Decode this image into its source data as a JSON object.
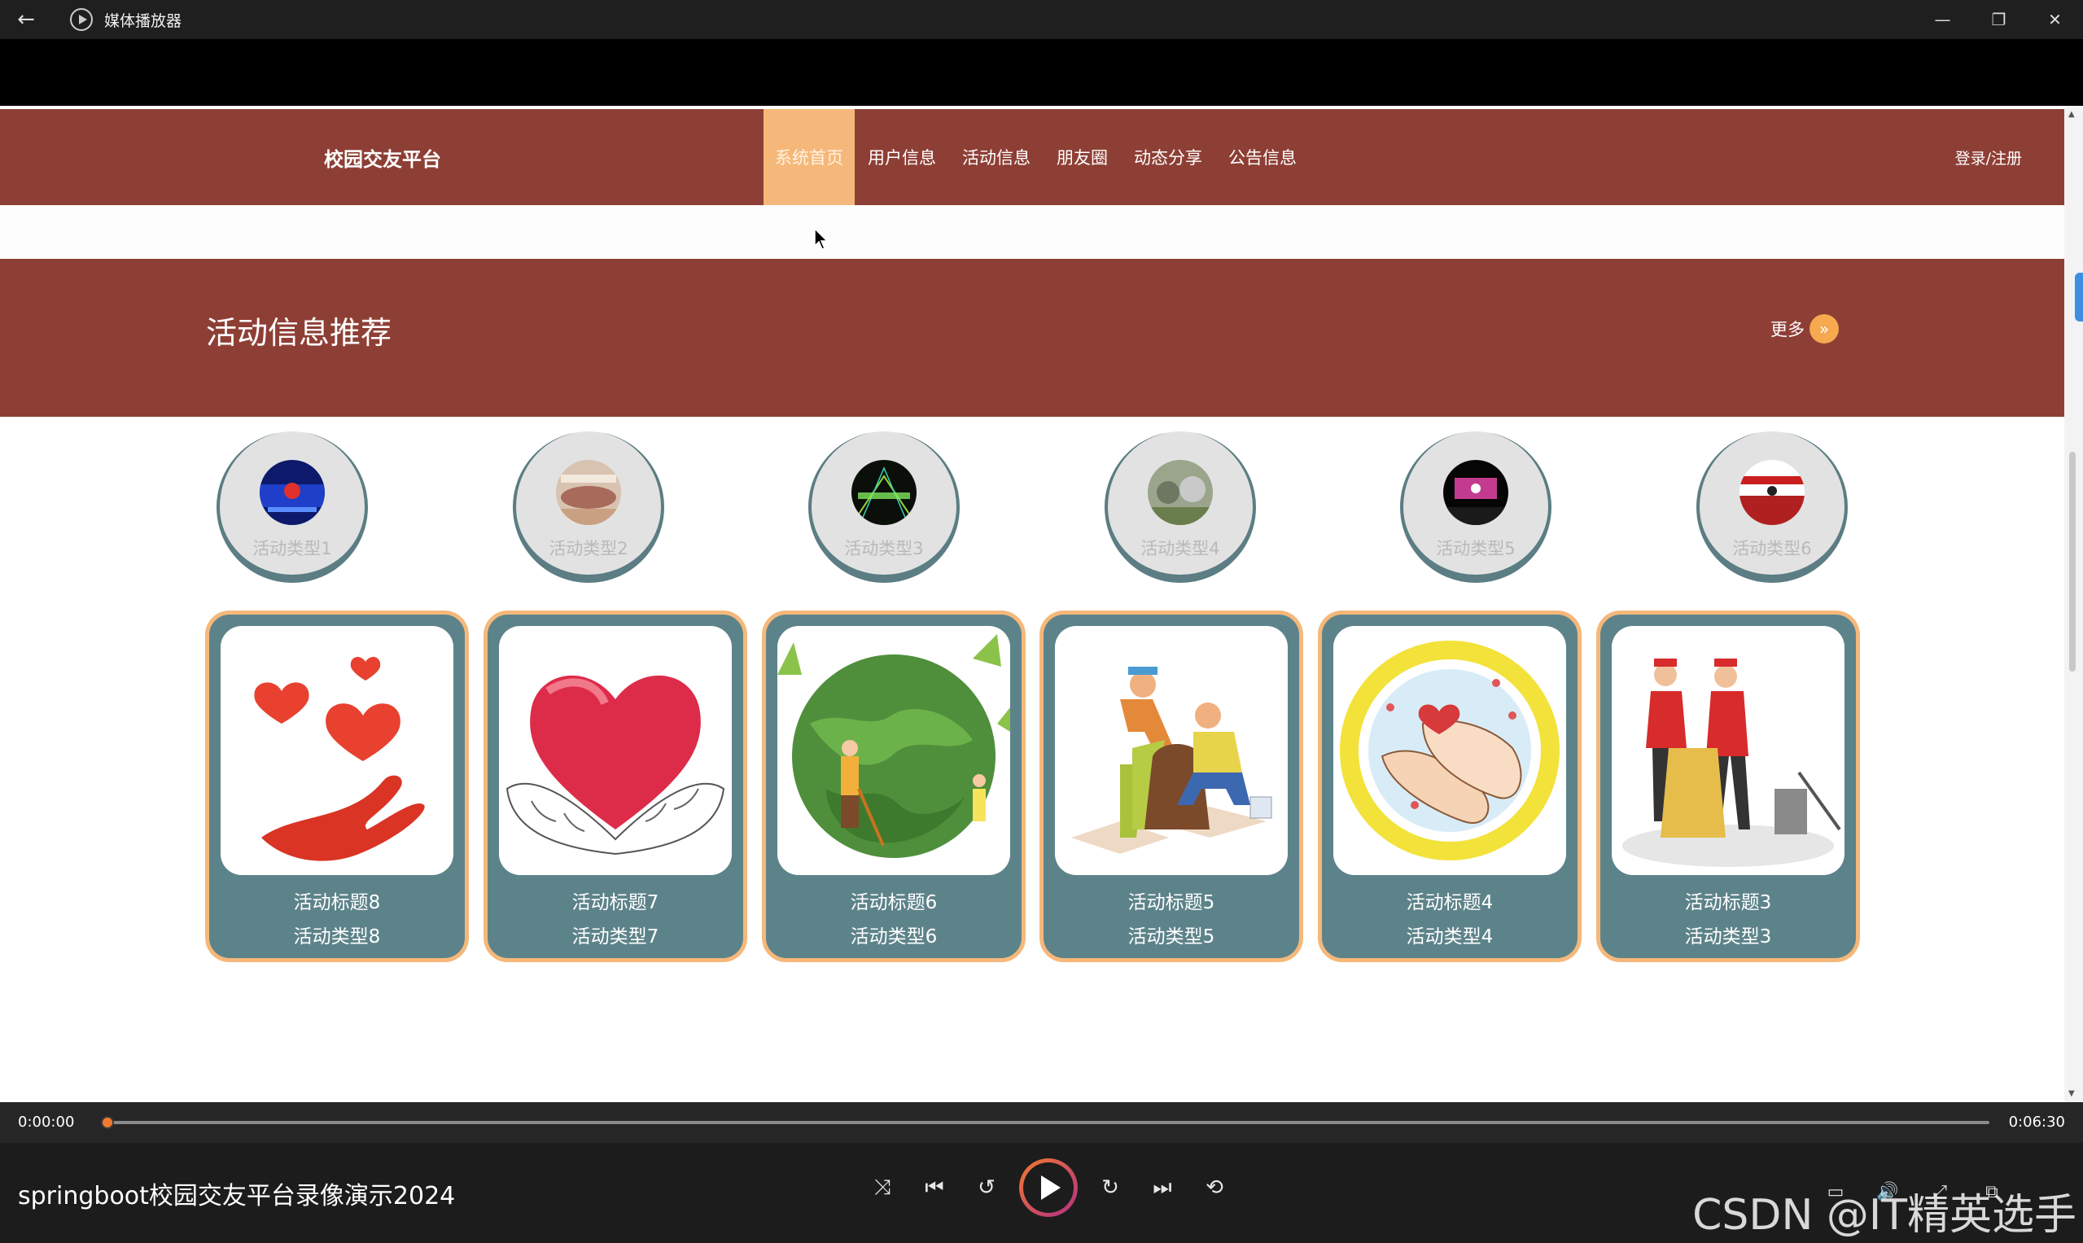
{
  "window": {
    "title": "媒体播放器",
    "back_icon": "←",
    "minimize": "—",
    "maximize": "❐",
    "close": "✕"
  },
  "site": {
    "brand": "校园交友平台",
    "nav": [
      "系统首页",
      "用户信息",
      "活动信息",
      "朋友圈",
      "动态分享",
      "公告信息"
    ],
    "active_nav": "系统首页",
    "login": "登录/注册"
  },
  "banner": {
    "title": "活动信息推荐",
    "more_label": "更多",
    "more_icon": "»"
  },
  "types": [
    "活动类型1",
    "活动类型2",
    "活动类型3",
    "活动类型4",
    "活动类型5",
    "活动类型6"
  ],
  "cards": [
    {
      "title": "活动标题8",
      "type": "活动类型8"
    },
    {
      "title": "活动标题7",
      "type": "活动类型7"
    },
    {
      "title": "活动标题6",
      "type": "活动类型6"
    },
    {
      "title": "活动标题5",
      "type": "活动类型5"
    },
    {
      "title": "活动标题4",
      "type": "活动类型4"
    },
    {
      "title": "活动标题3",
      "type": "活动类型3"
    }
  ],
  "player": {
    "current_time": "0:00:00",
    "duration": "0:06:30",
    "progress": 0,
    "media_title": "springboot校园交友平台录像演示2024",
    "watermark": "CSDN @IT精英选手",
    "accent_color": "#f07a2f"
  },
  "colors": {
    "nav_bg": "#8e3f35",
    "active_tab": "#f6b87a",
    "card_bg": "#5d838a",
    "card_border": "#f5b87a"
  }
}
